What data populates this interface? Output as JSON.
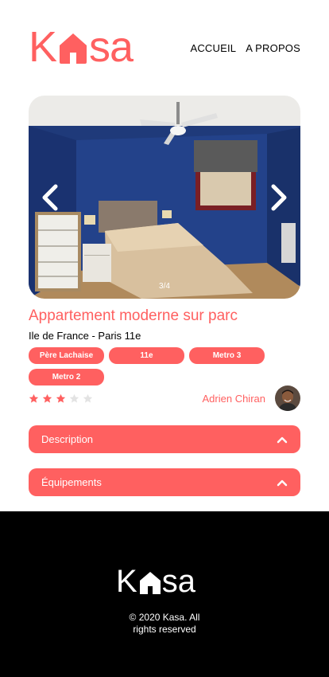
{
  "brand": {
    "logo_first": "K",
    "logo_rest": "sa",
    "accent_color": "#FF6060"
  },
  "nav": {
    "home_label": "ACCUEIL",
    "about_label": "A PROPOS"
  },
  "gallery": {
    "counter": "3/4",
    "prev_icon": "chevron-left-icon",
    "next_icon": "chevron-right-icon"
  },
  "listing": {
    "title": "Appartement moderne sur parc",
    "location": "Ile de France - Paris 11e",
    "tags": [
      "Père Lachaise",
      "11e",
      "Metro 3",
      "Metro 2"
    ],
    "rating": 3,
    "rating_max": 5,
    "host_name": "Adrien Chiran"
  },
  "collapses": {
    "description_label": "Description",
    "equipment_label": "Équipements",
    "toggle_icon": "chevron-up-icon"
  },
  "footer": {
    "copyright": "© 2020 Kasa. All\nrights reserved"
  }
}
